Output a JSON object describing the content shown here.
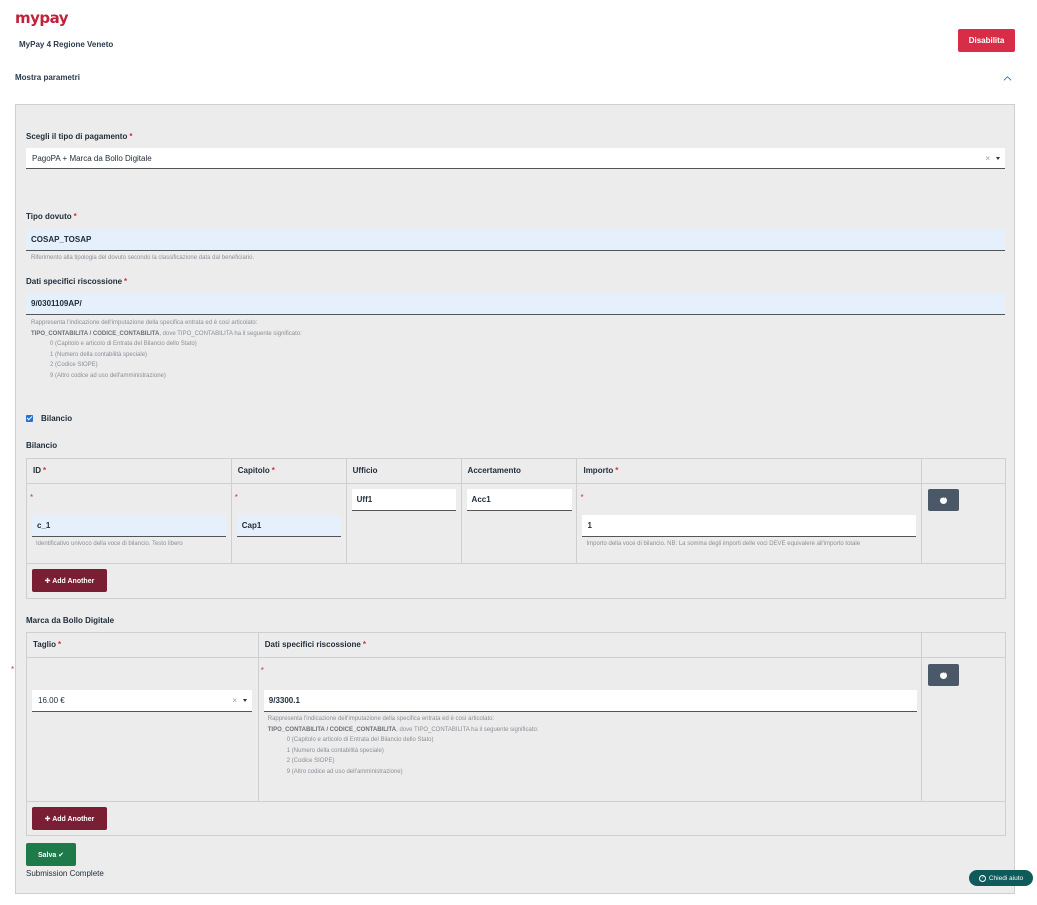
{
  "header": {
    "logo_text": "mypay",
    "app_title": "MyPay 4 Regione Veneto",
    "disable_label": "Disabilita"
  },
  "params_toggle": {
    "label": "Mostra parametri",
    "icon": "chevron-up-icon"
  },
  "form": {
    "payment_type": {
      "label": "Scegli il tipo di pagamento",
      "required": "*",
      "value": "PagoPA + Marca da Bollo Digitale",
      "clear": "×"
    },
    "tipo_dovuto": {
      "label": "Tipo dovuto",
      "required": "*",
      "value": "COSAP_TOSAP",
      "help": "Riferimento alla tipologia del dovuto secondo la classificazione data dal beneficiario."
    },
    "dati_specifici": {
      "label": "Dati specifici riscossione",
      "required": "*",
      "value": "9/0301109AP/",
      "help_line1": "Rappresenta l'indicazione dell'imputazione della specifica entrata ed è così articolato:",
      "help_line2_bold": "TIPO_CONTABILITA / CODICE_CONTABILITA",
      "help_line2_rest": ", dove TIPO_CONTABILITA ha il seguente significato:",
      "help_items": [
        "0 (Capitolo e articolo di Entrata del Bilancio dello Stato)",
        "1 (Numero della contabilità speciale)",
        "2 (Codice SIOPE)",
        "9 (Altro codice ad uso dell'amministrazione)"
      ]
    },
    "bilancio_checkbox": {
      "label": "Bilancio",
      "checked": true
    },
    "bilancio_grid": {
      "title": "Bilancio",
      "columns": [
        {
          "label": "ID",
          "required": "*"
        },
        {
          "label": "Capitolo",
          "required": "*"
        },
        {
          "label": "Ufficio",
          "required": ""
        },
        {
          "label": "Accertamento",
          "required": ""
        },
        {
          "label": "Importo",
          "required": "*"
        }
      ],
      "row": {
        "id": "c_1",
        "capitolo": "Cap1",
        "ufficio": "Uff1",
        "accertamento": "Acc1",
        "importo": "1"
      },
      "id_help": "Identificativo univoco della voce di bilancio. Testo libero",
      "importo_help": "Importo della voce di bilancio. NB: La somma degli importi delle voci DEVE equivalere all'importo totale",
      "add_label": "✚ Add Another"
    },
    "bollo_grid": {
      "title": "Marca da Bollo Digitale",
      "columns": [
        {
          "label": "Taglio",
          "required": "*"
        },
        {
          "label": "Dati specifici riscossione",
          "required": "*"
        }
      ],
      "row": {
        "taglio": "16.00 €",
        "dati": "9/3300.1"
      },
      "help_line1": "Rappresenta l'indicazione dell'imputazione della specifica entrata ed è così articolato:",
      "help_line2_bold": "TIPO_CONTABILITA / CODICE_CONTABILITA",
      "help_line2_rest": ", dove TIPO_CONTABILITA ha il seguente significato:",
      "help_items": [
        "0 (Capitolo e articolo di Entrata del Bilancio dello Stato)",
        "1 (Numero della contabilità speciale)",
        "2 (Codice SIOPE)",
        "9 (Altro codice ad uso dell'amministrazione)"
      ],
      "add_label": "✚ Add Another"
    },
    "save_label": "Salva ✔",
    "submission_text": "Submission Complete"
  },
  "help_chat": {
    "label": "Chiedi aiuto",
    "icon": "?"
  },
  "colors": {
    "brand": "#c2213a",
    "danger": "#d72d47",
    "add": "#7a1e33",
    "save": "#1f7a4a",
    "remove": "#4a5868",
    "help": "#0f5a5a"
  }
}
